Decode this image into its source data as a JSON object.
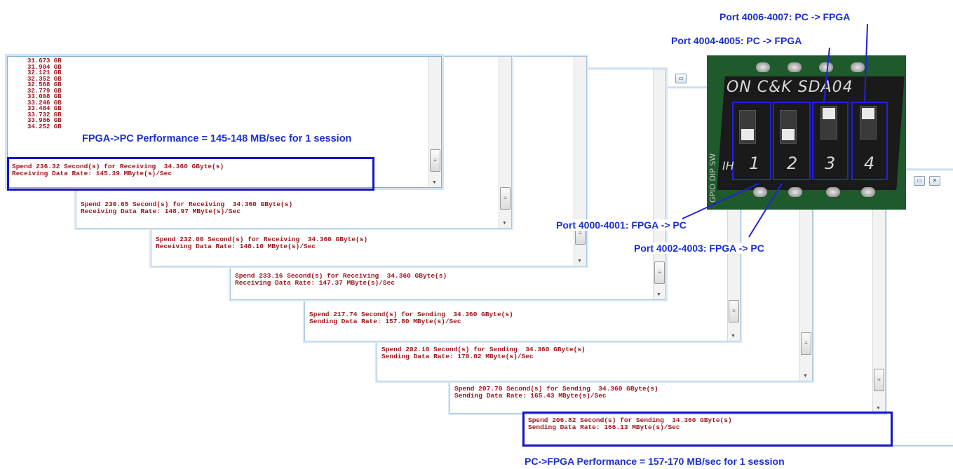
{
  "gb_list": [
    "31.673 GB",
    "31.904 GB",
    "32.121 GB",
    "32.352 GB",
    "32.568 GB",
    "32.779 GB",
    "33.008 GB",
    "33.246 GB",
    "33.484 GB",
    "33.732 GB",
    "33.986 GB",
    "34.252 GB"
  ],
  "windows": [
    {
      "line1": "Spend 236.32 Second(s) for Receiving  34.360 GByte(s)",
      "line2": "Receiving Data Rate: 145.39 MByte(s)/Sec"
    },
    {
      "line1": "Spend 230.65 Second(s) for Receiving  34.360 GByte(s)",
      "line2": "Receiving Data Rate: 148.97 MByte(s)/Sec"
    },
    {
      "line1": "Spend 232.00 Second(s) for Receiving  34.360 GByte(s)",
      "line2": "Receiving Data Rate: 148.10 MByte(s)/Sec"
    },
    {
      "line1": "Spend 233.16 Second(s) for Receiving  34.360 GByte(s)",
      "line2": "Receiving Data Rate: 147.37 MByte(s)/Sec"
    },
    {
      "line1": "Spend 217.74 Second(s) for Sending  34.360 GByte(s)",
      "line2": "Sending Data Rate: 157.80 MByte(s)/Sec"
    },
    {
      "line1": "Spend 202.10 Second(s) for Sending  34.360 GByte(s)",
      "line2": "Sending Data Rate: 170.02 MByte(s)/Sec"
    },
    {
      "line1": "Spend 207.70 Second(s) for Sending  34.360 GByte(s)",
      "line2": "Sending Data Rate: 165.43 MByte(s)/Sec"
    },
    {
      "line1": "Spend 206.82 Second(s) for Sending  34.360 GByte(s)",
      "line2": "Sending Data Rate: 166.13 MByte(s)/Sec"
    }
  ],
  "annotations": {
    "fpga_pc_perf": "FPGA->PC Performance = 145-148 MB/sec for 1 session",
    "pc_fpga_perf": "PC->FPGA Performance = 157-170 MB/sec for 1 session",
    "port_4006": "Port 4006-4007: PC -> FPGA",
    "port_4004": "Port 4004-4005: PC -> FPGA",
    "port_4000": "Port 4000-4001: FPGA -> PC",
    "port_4002": "Port 4002-4003: FPGA -> PC"
  },
  "dip_switch": {
    "brand": "ON C&K SDA04",
    "side_label": "GPIO DIP SW",
    "numbers": [
      "1",
      "2",
      "3",
      "4"
    ],
    "on_label": "IH",
    "switch_states": [
      "off",
      "off",
      "on",
      "on"
    ]
  },
  "colors": {
    "annotation_blue": "#1c2fd0",
    "console_text": "#a0151b",
    "highlight_border": "#1515c9"
  }
}
